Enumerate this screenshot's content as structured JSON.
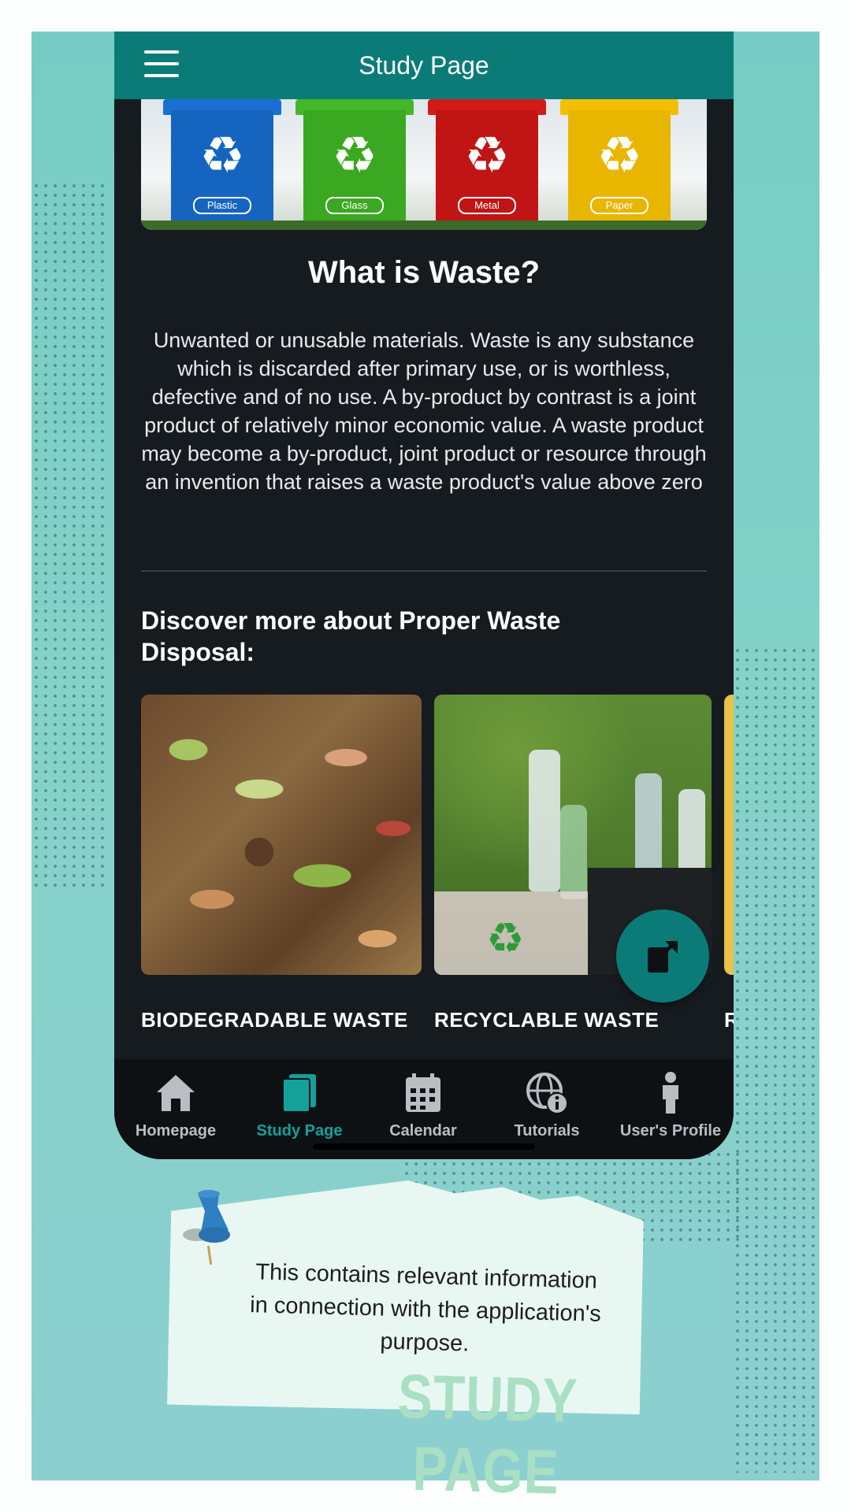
{
  "app": {
    "title": "Study Page"
  },
  "hero": {
    "bins": [
      {
        "label": "Plastic",
        "color": "#1565c0"
      },
      {
        "label": "Glass",
        "color": "#3aa820"
      },
      {
        "label": "Metal",
        "color": "#c11414"
      },
      {
        "label": "Paper",
        "color": "#e8b600"
      }
    ]
  },
  "content": {
    "heading": "What is Waste?",
    "body": "Unwanted or unusable materials. Waste is any substance which is discarded after primary use, or is worthless, defective and of no use. A by-product by contrast is a joint product of relatively minor economic value. A waste product may become a by-product, joint product or resource through an invention that raises a waste product's value above zero",
    "discover": "Discover more about Proper Waste Disposal:",
    "cards": [
      {
        "label": "BIODEGRADABLE WASTE"
      },
      {
        "label": "RECYCLABLE WASTE"
      },
      {
        "label": "R"
      }
    ]
  },
  "nav": {
    "items": [
      {
        "label": "Homepage",
        "icon": "home-icon"
      },
      {
        "label": "Study Page",
        "icon": "book-icon",
        "active": true
      },
      {
        "label": "Calendar",
        "icon": "calendar-icon"
      },
      {
        "label": "Tutorials",
        "icon": "globe-info-icon"
      },
      {
        "label": "User's Profile",
        "icon": "person-icon"
      }
    ]
  },
  "note": {
    "text": "This contains relevant information in connection with the application's purpose.",
    "title": "STUDY PAGE"
  },
  "colors": {
    "accent": "#0b7b78",
    "active_nav": "#14a19a",
    "background": "#161b20"
  }
}
